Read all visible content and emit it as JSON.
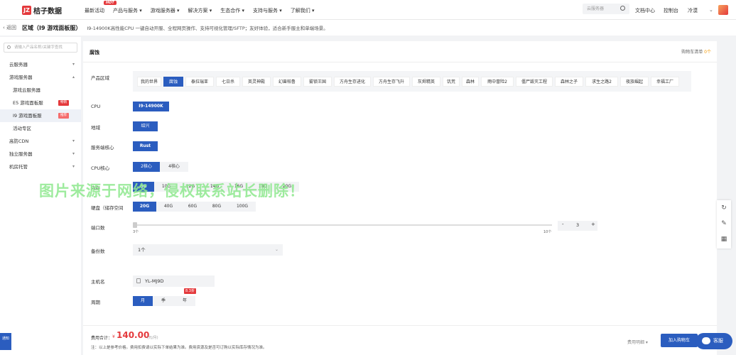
{
  "nav": {
    "logo_text": "桔子数据",
    "hot": "HOT",
    "menu": [
      "最新活动",
      "产品与服务 ▾",
      "游戏服务器 ▾",
      "解决方案 ▾",
      "生态合作 ▾",
      "支持与服务 ▾",
      "了解我们 ▾"
    ],
    "search_placeholder": "云服务器",
    "doc": "文档中心",
    "console": "控制台",
    "user": "冷漠"
  },
  "crumb": {
    "back": "返回",
    "title": "区域（I9 游戏面板服）",
    "desc": "I9-14900K高性能CPU 一键自动开服、全程网页操作、支持可视化管理/SFTP；友好体验，适合新手服主和单端场景。"
  },
  "sidebar": {
    "search_placeholder": "请输入产品名称/关键字查找",
    "items": [
      {
        "label": "云服务器",
        "arrow": "▾",
        "badge": "",
        "sub": false
      },
      {
        "label": "游戏服务器",
        "arrow": "▴",
        "badge": "",
        "sub": false
      },
      {
        "label": "游戏云服务器",
        "arrow": "",
        "badge": "",
        "sub": true
      },
      {
        "label": "E5 游戏面板服",
        "arrow": "",
        "badge": "畅销",
        "sub": true
      },
      {
        "label": "I9 游戏面板服",
        "arrow": "",
        "badge": "推荐",
        "sub": true
      },
      {
        "label": "活动专区",
        "arrow": "",
        "badge": "",
        "sub": true
      },
      {
        "label": "高防CDN",
        "arrow": "▾",
        "badge": "",
        "sub": false
      },
      {
        "label": "独立服务器",
        "arrow": "▾",
        "badge": "",
        "sub": false
      },
      {
        "label": "机房托管",
        "arrow": "▾",
        "badge": "",
        "sub": false
      }
    ]
  },
  "main": {
    "title": "腐蚀",
    "cart_label": "购物车清单",
    "cart_count": "0个",
    "labels": {
      "region": "产品区域",
      "cpu": "CPU",
      "area": "地域",
      "core": "服务端核心",
      "cpu_core": "CPU核心",
      "mem": "内存",
      "disk": "硬盘（储存空间",
      "ports": "端口数",
      "backup": "备份数",
      "host": "主机名",
      "period": "周期"
    },
    "regions": [
      "我的世界",
      "腐蚀",
      "泰拉瑞亚",
      "七日杀",
      "英灵神殿",
      "幻兽帕鲁",
      "雾锁王国",
      "方舟生存进化",
      "方舟生存飞升",
      "灰烬精英",
      "饥荒",
      "森林",
      "雨中冒险2",
      "僵尸毁灭工程",
      "森林之子",
      "求生之路2",
      "夜族崛起",
      "幸福工厂"
    ],
    "cpu": [
      "I9-14900K"
    ],
    "area": [
      "绍兴"
    ],
    "core": [
      "Rust"
    ],
    "cpu_core": [
      "2核心",
      "4核心"
    ],
    "mem": [
      "8G",
      "10G",
      "12G",
      "14G",
      "16G",
      "18G",
      "20G"
    ],
    "disk": [
      "20G",
      "40G",
      "60G",
      "80G",
      "100G"
    ],
    "slider_min": "3个",
    "slider_max": "10个",
    "stepper_minus": "-",
    "stepper_value": "3",
    "stepper_plus": "+",
    "backup": "1个",
    "host": "YL-MJ9D",
    "discount": "8.3折",
    "period": [
      "月",
      "季",
      "年"
    ]
  },
  "footer": {
    "total_label": "费用合计：",
    "currency": "¥",
    "price": "140.00",
    "orig": "(元/月)",
    "note": "注：以上是参考价格。费用扣费请以实际下单结果为准。费用资源及是否可订购以实际库存情况为准。",
    "detail": "费用明细 ▾",
    "buy": "加入购物车"
  },
  "float": {
    "chat": "客服",
    "lefttab": "通知"
  },
  "watermark": "图片来源于网络，侵权联系站长删除！"
}
